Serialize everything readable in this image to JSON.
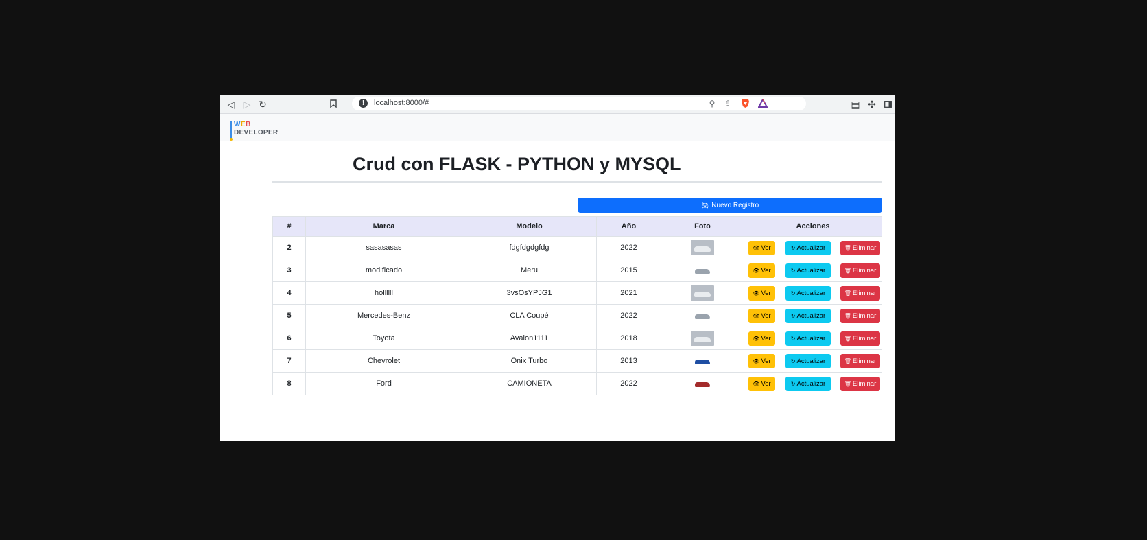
{
  "browser": {
    "url": "localhost:8000/#"
  },
  "navbar": {
    "logo_top_w": "W",
    "logo_top_e": "E",
    "logo_top_b": "B",
    "logo_bottom": "DEVELOPER"
  },
  "page": {
    "title": "Crud con FLASK - PYTHON y MYSQL",
    "new_button": "Nuevo Registro"
  },
  "table": {
    "headers": [
      "#",
      "Marca",
      "Modelo",
      "Año",
      "Foto",
      "Acciones"
    ],
    "rows": [
      {
        "id": "2",
        "marca": "sasasasas",
        "modelo": "fdgfdgdgfdg",
        "anio": "2022"
      },
      {
        "id": "3",
        "marca": "modificado",
        "modelo": "Meru",
        "anio": "2015"
      },
      {
        "id": "4",
        "marca": "hollllll",
        "modelo": "3vsOsYPJG1",
        "anio": "2021"
      },
      {
        "id": "5",
        "marca": "Mercedes-Benz",
        "modelo": "CLA Coupé",
        "anio": "2022"
      },
      {
        "id": "6",
        "marca": "Toyota",
        "modelo": "Avalon1111",
        "anio": "2018"
      },
      {
        "id": "7",
        "marca": "Chevrolet",
        "modelo": "Onix Turbo",
        "anio": "2013"
      },
      {
        "id": "8",
        "marca": "Ford",
        "modelo": "CAMIONETA",
        "anio": "2022"
      }
    ],
    "actions": {
      "view": "Ver",
      "update": "Actualizar",
      "delete": "Eliminar"
    }
  },
  "colors": {
    "primary": "#0d6efd",
    "warning": "#ffc107",
    "info": "#0dcaf0",
    "danger": "#dc3545",
    "table_header": "#e6e6f9"
  },
  "icons": [
    "back-icon",
    "forward-icon",
    "reload-icon",
    "bookmark-icon",
    "info-icon",
    "zoom-icon",
    "share-icon",
    "brave-icon",
    "triangle-icon",
    "clipboard-icon",
    "extensions-icon",
    "sidebar-icon",
    "car-icon",
    "eye-icon",
    "refresh-icon",
    "trash-icon"
  ]
}
